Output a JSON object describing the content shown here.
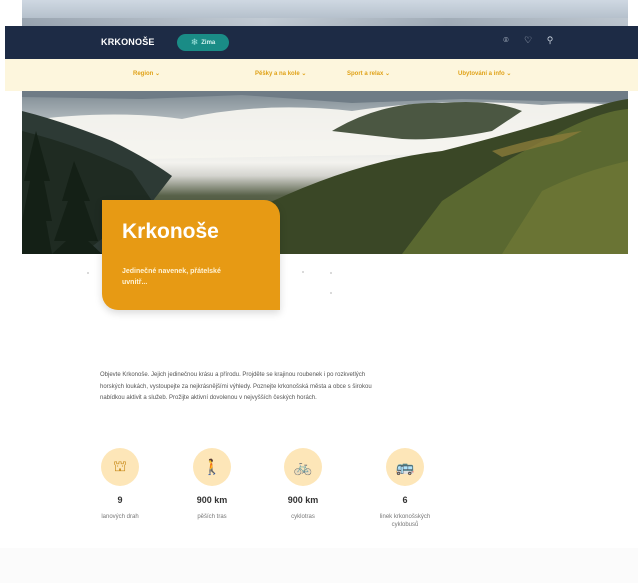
{
  "header": {
    "logo": "KRKONOŠE",
    "season_toggle": {
      "label": "Zima",
      "icon": "snowflake-icon"
    },
    "icons": [
      "location-icon",
      "heart-icon",
      "search-icon"
    ]
  },
  "menu": {
    "items": [
      {
        "label": "Region ⌄"
      },
      {
        "label": "Pěšky a na kole ⌄"
      },
      {
        "label": "Sport a relax ⌄"
      },
      {
        "label": "Ubytování a info ⌄"
      }
    ]
  },
  "hero": {
    "title": "Krkonoše",
    "subtitle": "Jedinečné navenek, přátelské uvnitř..."
  },
  "intro": {
    "text": "Objevte Krkonoše. Jejich jedinečnou krásu a přírodu. Projděte se krajinou roubenek i po rozkvetlých horských loukách, vystoupejte za nejkrásnějšími výhledy. Poznejte krkonošská města a obce s širokou nabídkou aktivit a služeb. Prožijte aktivní dovolenou v nejvyšších českých horách."
  },
  "stats": [
    {
      "value": "9",
      "label": "lanových drah",
      "icon": "cable-car-icon"
    },
    {
      "value": "900 km",
      "label": "pěších tras",
      "icon": "hiker-icon"
    },
    {
      "value": "900 km",
      "label": "cyklotras",
      "icon": "bicycle-icon"
    },
    {
      "value": "6",
      "label": "linek krkonošských cyklobusů",
      "icon": "bus-icon"
    }
  ],
  "colors": {
    "navbar": "#1d2b45",
    "menubar": "#fdf6dd",
    "accent": "#e79a14",
    "season_pill": "#1a8c86",
    "stat_circle": "#fde6b8"
  }
}
